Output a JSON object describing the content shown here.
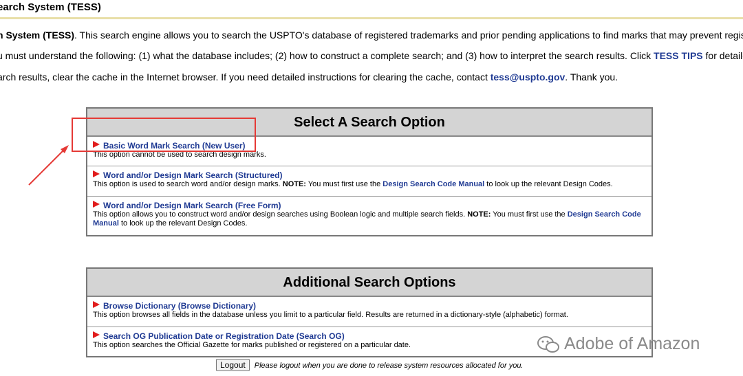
{
  "header": {
    "title": "earch System (TESS)"
  },
  "intro": {
    "line1": {
      "bold": "n System (TESS)",
      "rest": ". This search engine allows you to search the USPTO's database of registered trademarks and prior pending applications to find marks that may prevent registra"
    },
    "line2": {
      "before": "u must understand the following: (1) what the database includes; (2) how to construct a complete search; and (3) how to interpret the search results. Click ",
      "link": "TESS TIPS",
      "after": " for detailed"
    },
    "line3": {
      "before": "arch results, clear the cache in the Internet browser. If you need detailed instructions for clearing the cache, contact ",
      "link": "tess@uspto.gov",
      "after": ". Thank you."
    }
  },
  "select_panel": {
    "title": "Select A Search Option",
    "options": [
      {
        "label": "Basic Word Mark Search (New User)",
        "desc": "This option cannot be used to search design marks."
      },
      {
        "label": "Word and/or Design Mark Search (Structured)",
        "desc_before": "This option is used to search word and/or design marks. ",
        "note": "NOTE:",
        "desc_mid": " You must first use the ",
        "link": "Design Search Code Manual",
        "desc_after": " to look up the relevant Design Codes."
      },
      {
        "label": "Word and/or Design Mark Search (Free Form)",
        "desc_before": "This option allows you to construct word and/or design searches using Boolean logic and multiple search fields. ",
        "note": "NOTE:",
        "desc_mid": " You must first use the ",
        "link": "Design Search Code Manual",
        "desc_after": " to look up the relevant Design Codes."
      }
    ]
  },
  "additional_panel": {
    "title": "Additional Search Options",
    "options": [
      {
        "label": "Browse Dictionary (Browse Dictionary)",
        "desc": "This option browses all fields in the database unless you limit to a particular field. Results are returned in a dictionary-style (alphabetic) format."
      },
      {
        "label": "Search OG Publication Date or Registration Date (Search OG)",
        "desc": "This option searches the Official Gazette for marks published or registered on a particular date."
      }
    ]
  },
  "logout": {
    "button": "Logout",
    "note": "Please logout when you are done to release system resources allocated for you."
  },
  "watermark": {
    "text": "Adobe of Amazon"
  },
  "colors": {
    "link": "#1f3a93",
    "bullet": "#e11c1c",
    "highlight": "#e53935",
    "panel_header": "#d4d4d4"
  }
}
